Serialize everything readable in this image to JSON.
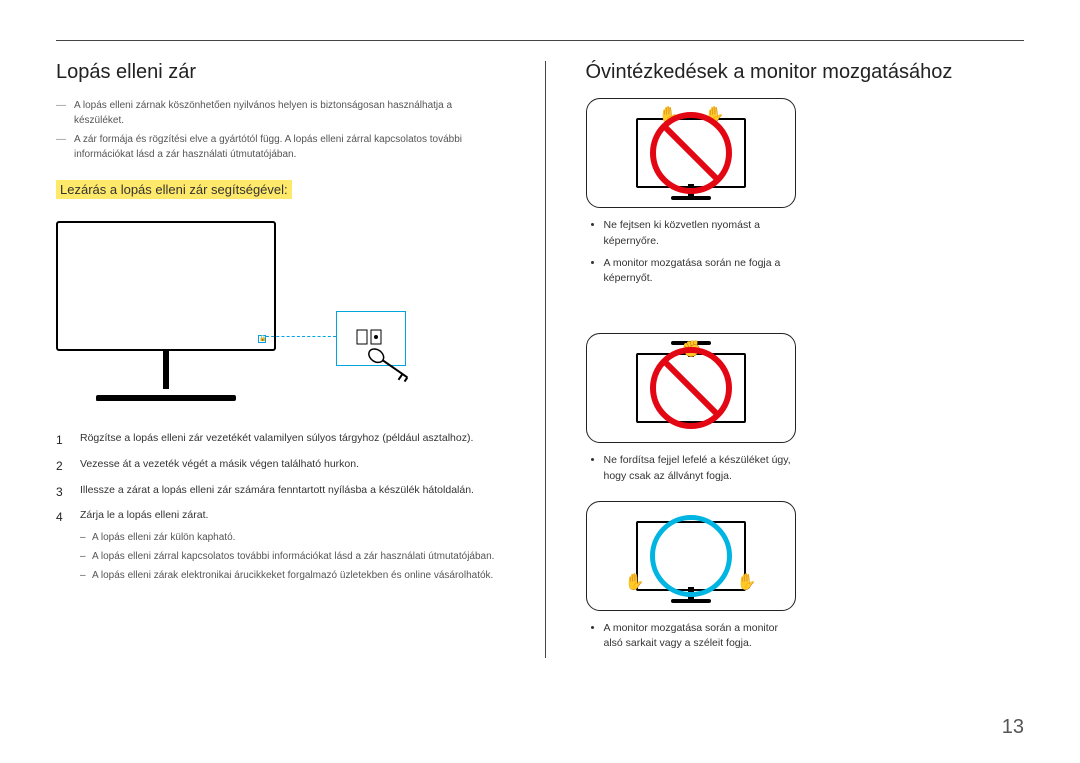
{
  "left": {
    "title": "Lopás elleni zár",
    "note1": "A lopás elleni zárnak köszönhetően nyilvános helyen is biztonságosan használhatja a készüléket.",
    "note2": "A zár formája és rögzítési elve a gyártótól függ. A lopás elleni zárral kapcsolatos további információkat lásd a zár használati útmutatójában.",
    "subheading": "Lezárás a lopás elleni zár segítségével:",
    "steps": [
      "Rögzítse a lopás elleni zár vezetékét valamilyen súlyos tárgyhoz (például asztalhoz).",
      "Vezesse át a vezeték végét a másik végen található hurkon.",
      "Illessze a zárat a lopás elleni zár számára fenntartott nyílásba a készülék hátoldalán.",
      "Zárja le a lopás elleni zárat."
    ],
    "substeps": [
      "A lopás elleni zár külön kapható.",
      "A lopás elleni zárral kapcsolatos további információkat lásd a zár használati útmutatójában.",
      "A lopás elleni zárak elektronikai árucikkeket forgalmazó üzletekben és online vásárolhatók."
    ]
  },
  "right": {
    "title": "Óvintézkedések a monitor mozgatásához",
    "bullets_a": [
      "Ne fejtsen ki közvetlen nyomást a képernyőre.",
      "A monitor mozgatása során ne fogja a képernyőt."
    ],
    "bullets_b": [
      "Ne fordítsa fejjel lefelé a készüléket úgy, hogy csak az állványt fogja."
    ],
    "bullets_c": [
      "A monitor mozgatása során a monitor alsó sarkait vagy a széleit fogja."
    ]
  },
  "page_number": "13"
}
